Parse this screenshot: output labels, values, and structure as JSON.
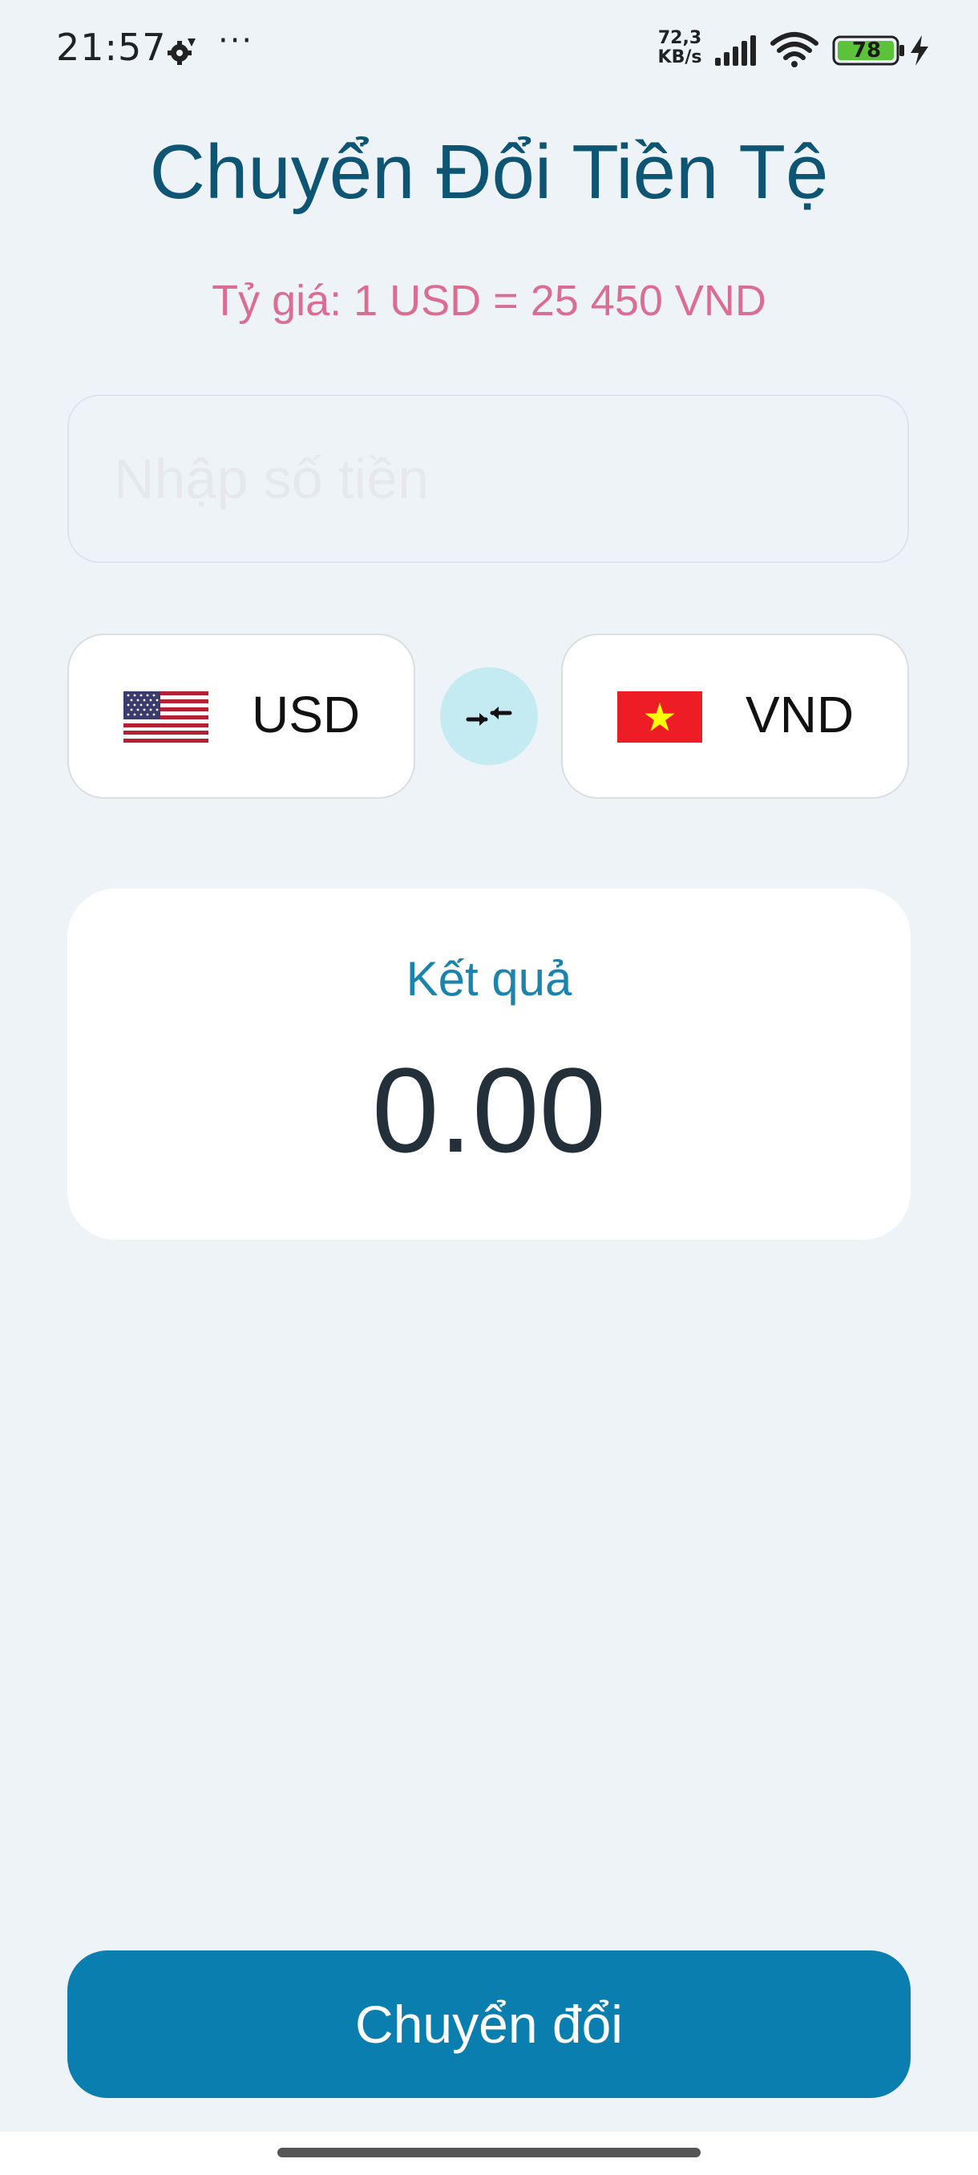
{
  "status_bar": {
    "time": "21:57",
    "speed_value": "72,3",
    "speed_unit": "KB/s",
    "battery": "78",
    "icons": [
      "settings-gear-icon",
      "more-dots-icon",
      "signal-icon",
      "wifi-icon",
      "battery-icon",
      "charging-bolt-icon"
    ],
    "dots": "···"
  },
  "header": {
    "title": "Chuyển Đổi Tiền Tệ",
    "rate": "Tỷ giá: 1 USD = 25 450 VND"
  },
  "amount_input": {
    "value": "",
    "placeholder": "Nhập số tiền"
  },
  "converter": {
    "from": {
      "code": "USD",
      "flag_icon": "us-flag-icon"
    },
    "to": {
      "code": "VND",
      "flag_icon": "vietnam-flag-icon"
    },
    "swap_icon": "swap-arrows-icon"
  },
  "result": {
    "label": "Kết quả",
    "value": "0.00"
  },
  "actions": {
    "convert_label": "Chuyển đổi"
  },
  "colors": {
    "background": "#eef3f8",
    "title": "#0e5573",
    "rate": "#d96e92",
    "accent": "#0a7eaf",
    "result_label": "#1b84ad",
    "swap_bg": "#c4ebf2"
  }
}
